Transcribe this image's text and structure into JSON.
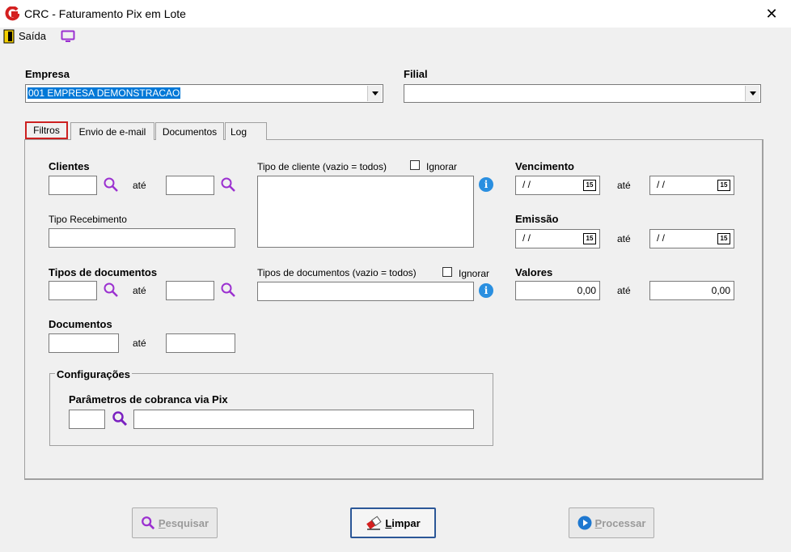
{
  "window": {
    "title": "CRC - Faturamento Pix em Lote"
  },
  "toolbar": {
    "exit_label": "Saída"
  },
  "empresa": {
    "label": "Empresa",
    "value": "001 EMPRESA DEMONSTRACAO"
  },
  "filial": {
    "label": "Filial",
    "value": ""
  },
  "tabs": [
    {
      "label": "Filtros",
      "active": true
    },
    {
      "label": "Envio de e-mail"
    },
    {
      "label": "Documentos"
    },
    {
      "label": "Log"
    }
  ],
  "filtros": {
    "clientes_label": "Clientes",
    "ate": "até",
    "tipo_recebimento_label": "Tipo Recebimento",
    "tipos_documentos_label": "Tipos de documentos",
    "documentos_label": "Documentos",
    "tipo_cliente_label": "Tipo de cliente (vazio = todos)",
    "ignorar": "Ignorar",
    "tipos_doc_vazio_label": "Tipos de documentos (vazio = todos)",
    "vencimento_label": "Vencimento",
    "emissao_label": "Emissão",
    "valores_label": "Valores",
    "date_empty": "/ /",
    "cal_glyph": "15",
    "valor_de": "0,00",
    "valor_ate": "0,00",
    "config_legend": "Configurações",
    "pix_param_label": "Parâmetros de cobranca via Pix"
  },
  "buttons": {
    "pesquisar_first": "P",
    "pesquisar_rest": "esquisar",
    "limpar_first": "L",
    "limpar_rest": "impar",
    "processar_first": "P",
    "processar_rest": "rocessar"
  },
  "colors": {
    "accent_purple": "#9b30d0",
    "logo_red": "#d42020",
    "focus_border": "#cc2020",
    "selection": "#0078d7"
  }
}
